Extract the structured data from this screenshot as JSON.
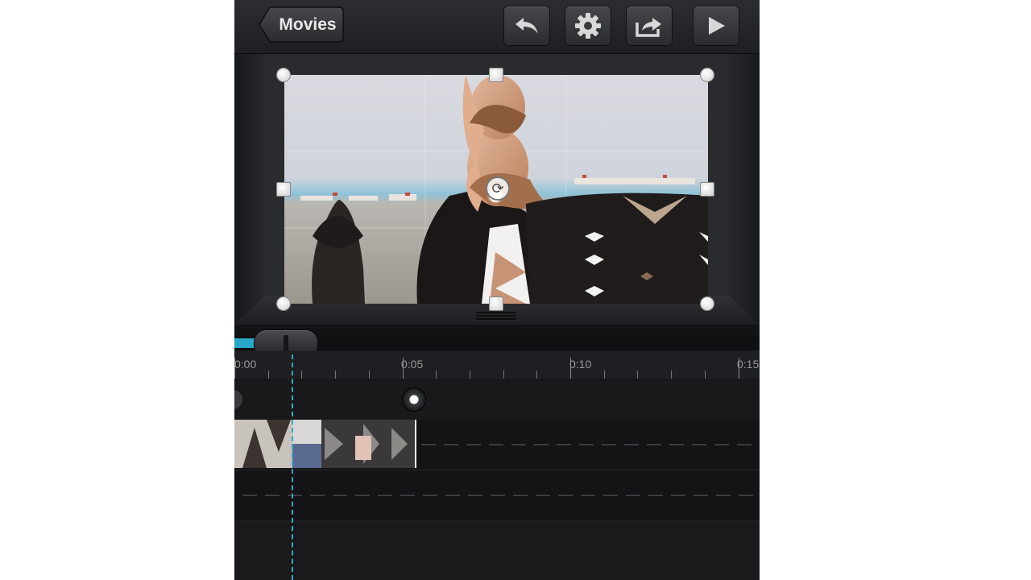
{
  "toolbar": {
    "back_label": "Movies",
    "buttons": [
      {
        "name": "undo-button",
        "icon": "undo-icon"
      },
      {
        "name": "settings-button",
        "icon": "gear-icon"
      },
      {
        "name": "share-button",
        "icon": "share-icon"
      },
      {
        "name": "play-button",
        "icon": "play-icon"
      }
    ]
  },
  "scrubber": {
    "progress": 0.06
  },
  "ruler": {
    "labels": [
      "0:00",
      "0:05",
      "0:10",
      "0:15"
    ]
  },
  "colors": {
    "accent": "#2aa6c8",
    "background": "#1b1c1f"
  }
}
